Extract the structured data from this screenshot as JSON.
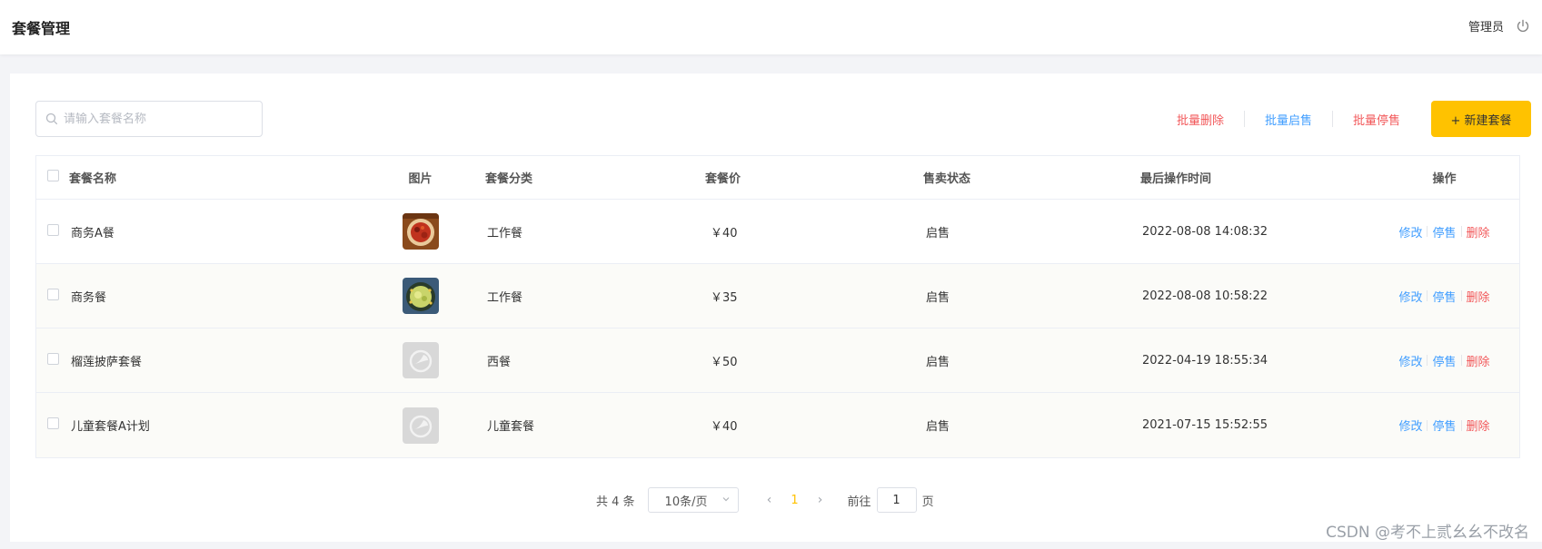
{
  "header": {
    "title": "套餐管理",
    "user": "管理员"
  },
  "search": {
    "placeholder": "请输入套餐名称",
    "value": ""
  },
  "toolbar": {
    "batch_delete": "批量删除",
    "batch_start": "批量启售",
    "batch_stop": "批量停售",
    "new_button": "+ 新建套餐"
  },
  "table": {
    "columns": [
      "套餐名称",
      "图片",
      "套餐分类",
      "套餐价",
      "售卖状态",
      "最后操作时间",
      "操作"
    ],
    "rows": [
      {
        "name": "商务A餐",
        "image": "food-photo-red",
        "category": "工作餐",
        "price": "￥40",
        "status": "启售",
        "time": "2022-08-08 14:08:32"
      },
      {
        "name": "商务餐",
        "image": "food-photo-green",
        "category": "工作餐",
        "price": "￥35",
        "status": "启售",
        "time": "2022-08-08 10:58:22"
      },
      {
        "name": "榴莲披萨套餐",
        "image": "placeholder-logo",
        "category": "西餐",
        "price": "￥50",
        "status": "启售",
        "time": "2022-04-19 18:55:34"
      },
      {
        "name": "儿童套餐A计划",
        "image": "placeholder-logo",
        "category": "儿童套餐",
        "price": "￥40",
        "status": "启售",
        "time": "2021-07-15 15:52:55"
      }
    ],
    "ops": {
      "edit": "修改",
      "stop": "停售",
      "delete": "删除"
    }
  },
  "pagination": {
    "total": "共 4 条",
    "page_size": "10条/页",
    "current_page": "1",
    "goto_label": "前往",
    "goto_value": "1",
    "page_suffix": "页"
  },
  "watermark": "CSDN @考不上贰幺幺不改名",
  "colors": {
    "accent": "#ffc200",
    "link_blue": "#419eff",
    "link_red": "#f2585a"
  }
}
